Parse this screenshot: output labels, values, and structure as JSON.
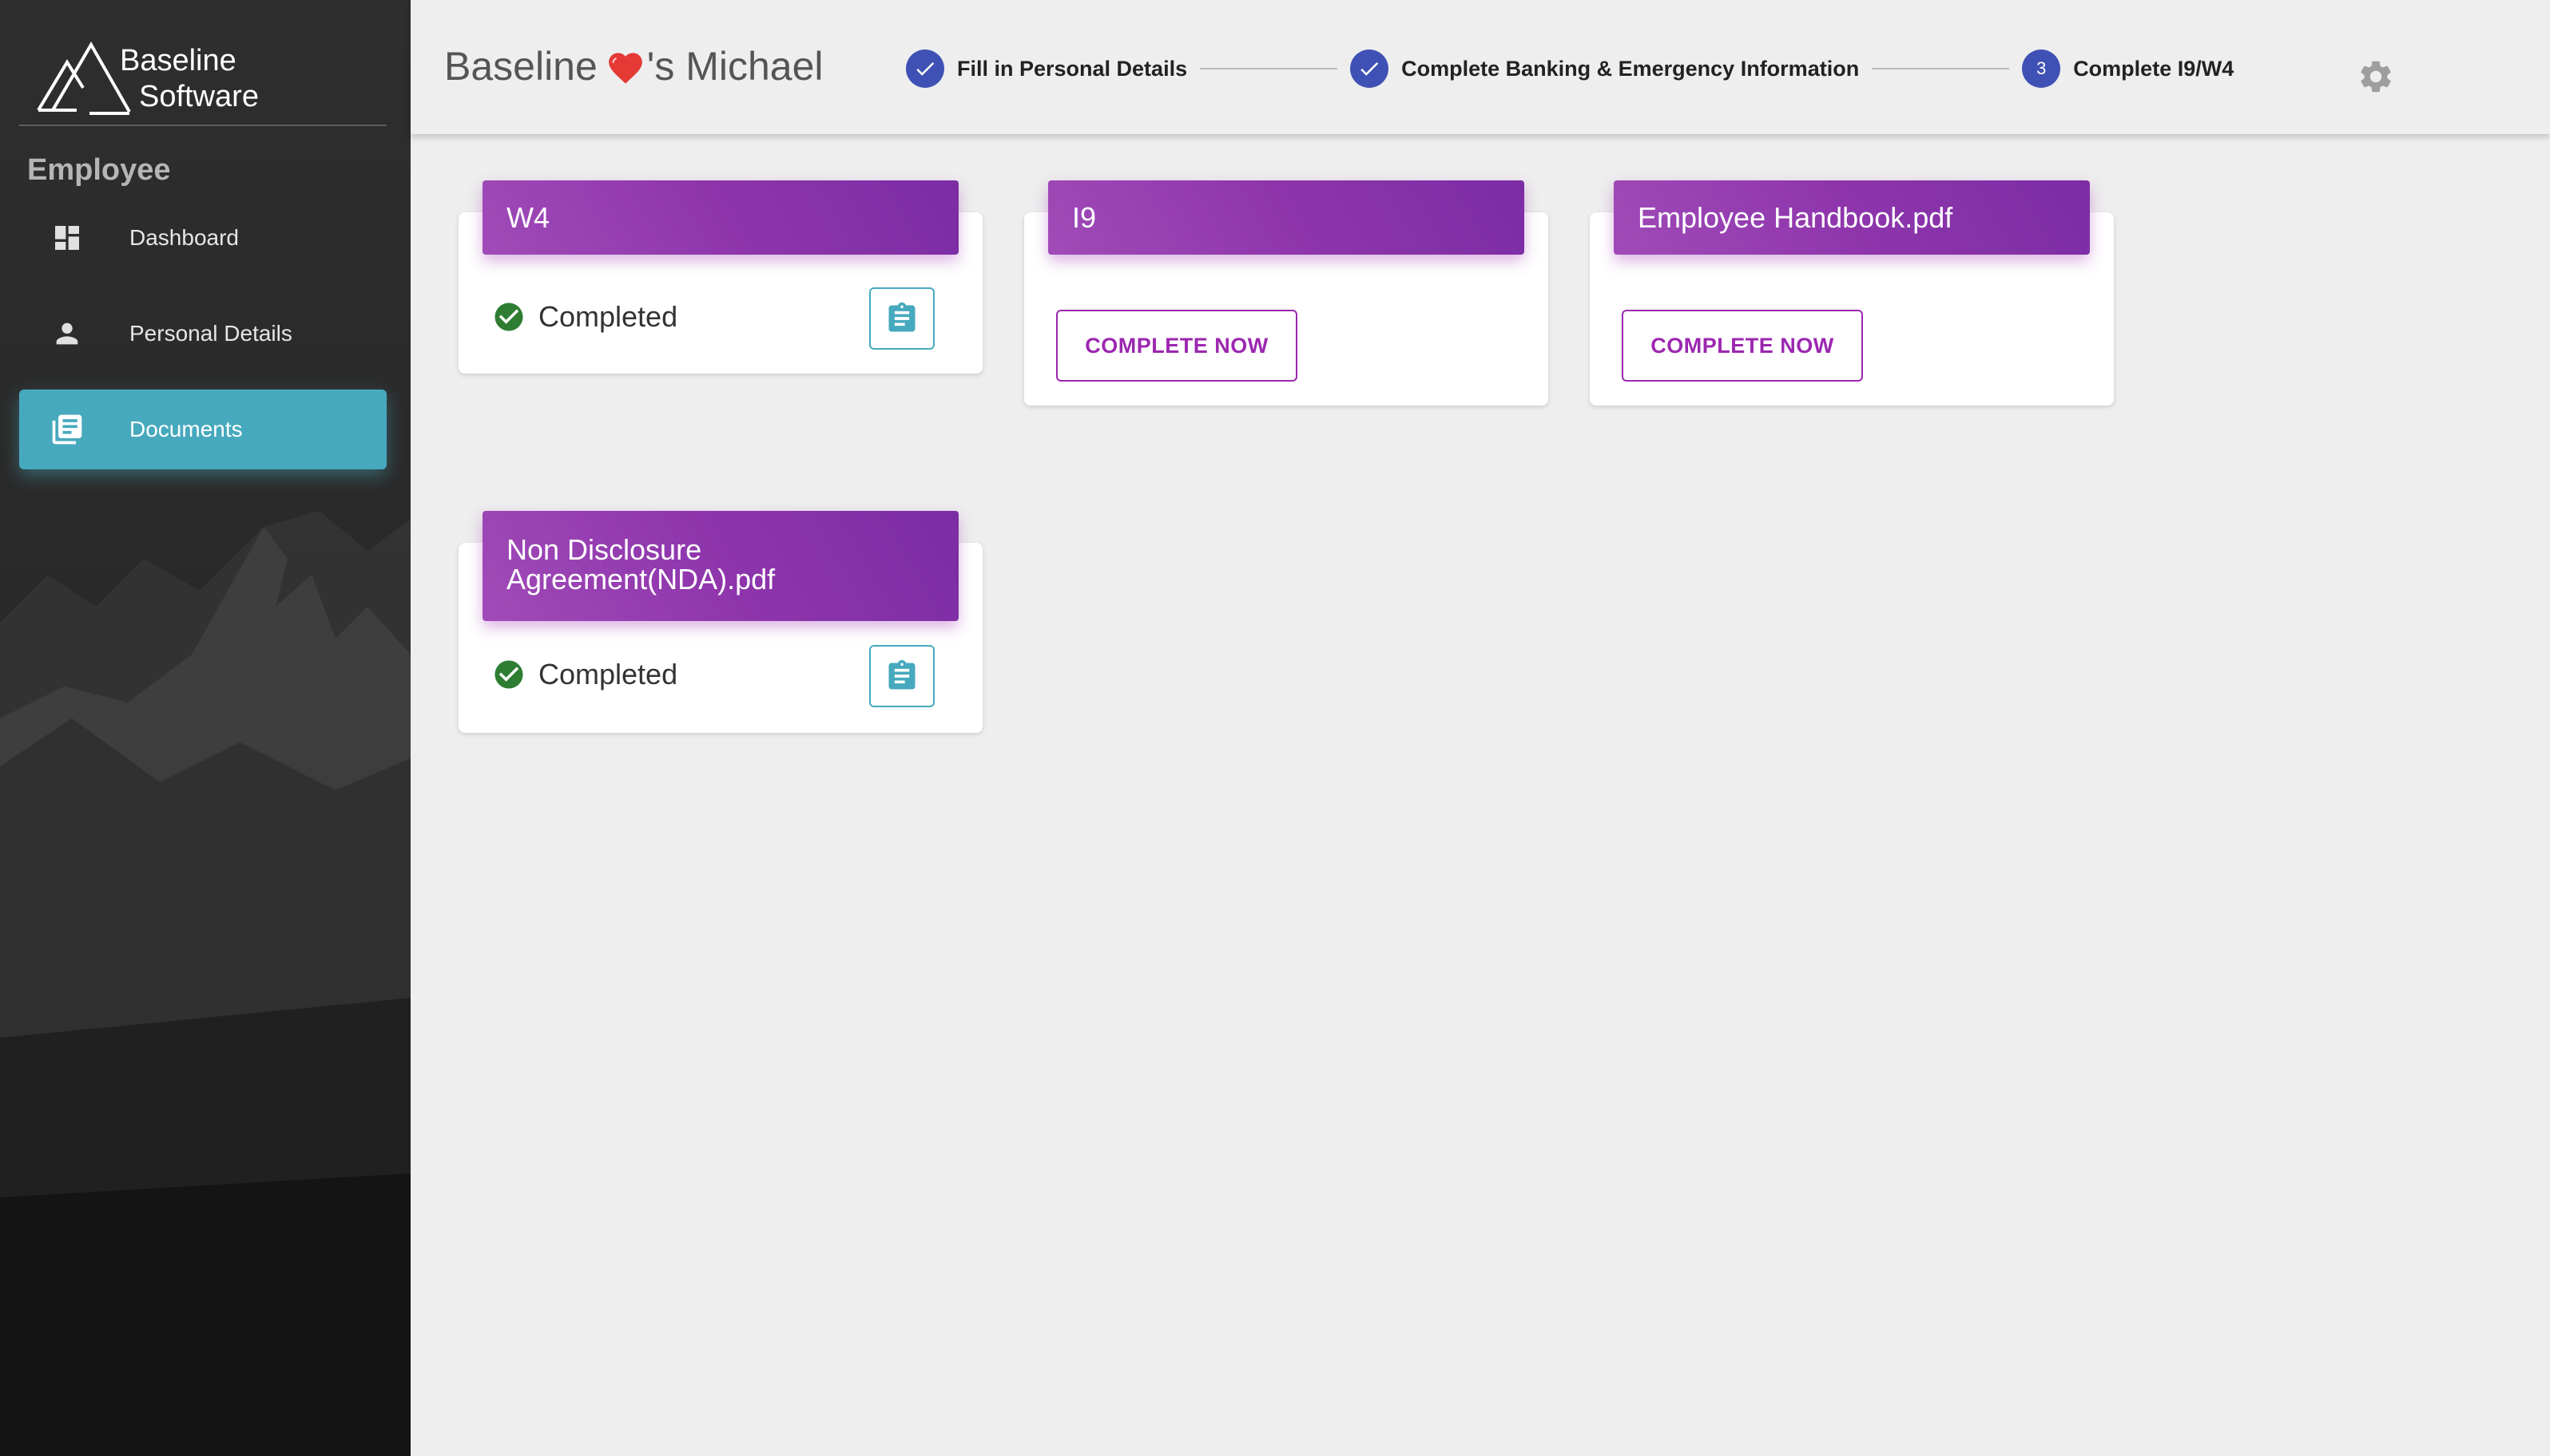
{
  "sidebar": {
    "logo": {
      "line1": "Baseline",
      "line2": "Software"
    },
    "section_title": "Employee",
    "items": [
      {
        "label": "Dashboard",
        "icon": "dashboard-icon",
        "active": false
      },
      {
        "label": "Personal Details",
        "icon": "person-icon",
        "active": false
      },
      {
        "label": "Documents",
        "icon": "documents-icon",
        "active": true
      }
    ]
  },
  "header": {
    "title_prefix": "Baseline",
    "title_suffix": "'s Michael",
    "heart_icon": "heart-icon",
    "steps": [
      {
        "label": "Fill in Personal Details",
        "state": "completed",
        "marker": "check-icon"
      },
      {
        "label": "Complete Banking & Emergency Information",
        "state": "completed",
        "marker": "check-icon"
      },
      {
        "label": "Complete I9/W4",
        "state": "active",
        "marker": "3"
      }
    ],
    "settings_icon": "gear-icon"
  },
  "documents": [
    {
      "title": "W4",
      "status": "Completed",
      "action": "view"
    },
    {
      "title": "I9",
      "status": "",
      "action_label": "COMPLETE NOW"
    },
    {
      "title": "Employee Handbook.pdf",
      "status": "",
      "action_label": "COMPLETE NOW"
    },
    {
      "title": "Non Disclosure Agreement(NDA).pdf",
      "status": "Completed",
      "action": "view"
    }
  ],
  "colors": {
    "accent_teal": "#47a9be",
    "card_header_purple": "#8e35ac",
    "button_purple": "#9c27b0",
    "step_blue": "#3f51b5",
    "success_green": "#2e7d32"
  }
}
